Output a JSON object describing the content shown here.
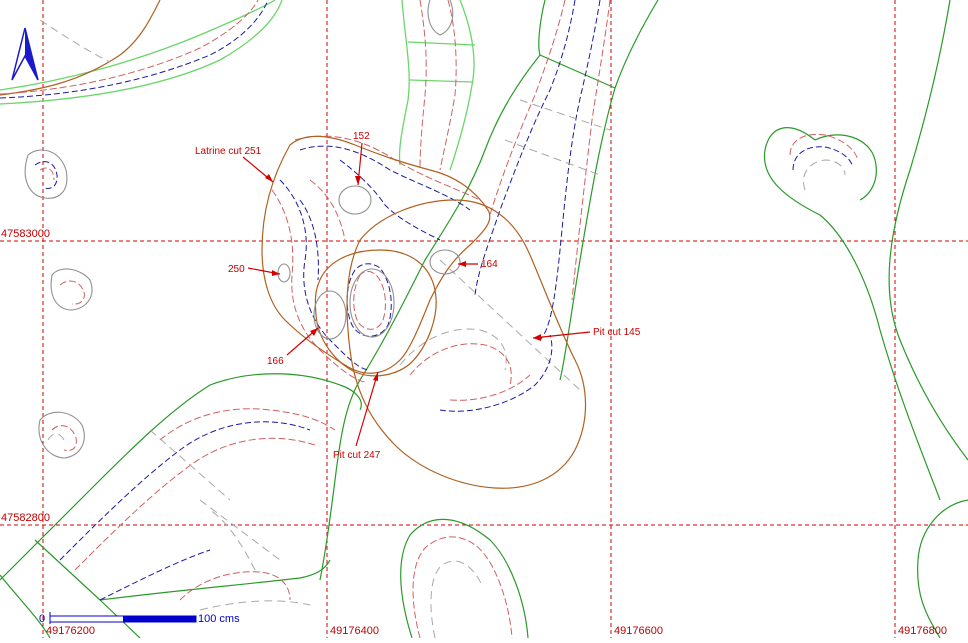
{
  "map": {
    "grid": {
      "x_labels": [
        "49176200",
        "49176400",
        "49176600",
        "49176800"
      ],
      "y_labels": [
        "47583000",
        "47582800"
      ]
    },
    "features": [
      {
        "label": "Latrine cut 251"
      },
      {
        "label": "152"
      },
      {
        "label": "250"
      },
      {
        "label": "164"
      },
      {
        "label": "Pit cut 145"
      },
      {
        "label": "166"
      },
      {
        "label": "Pit cut 247"
      }
    ],
    "scale_bar": {
      "start": "0",
      "end": "100 cms"
    },
    "north_arrow": "north-arrow-icon",
    "colors": {
      "grid": "#d40000",
      "labels": "#c80000",
      "terrain_outline": "#2a9a2a",
      "trench_edge": "#6ad66a",
      "cut_outline": "#b06020",
      "contour_blue": "#1a1aa0",
      "contour_red": "#d06060",
      "contour_grey": "#a8a8a8",
      "north_arrow": "#1a1acc"
    }
  }
}
